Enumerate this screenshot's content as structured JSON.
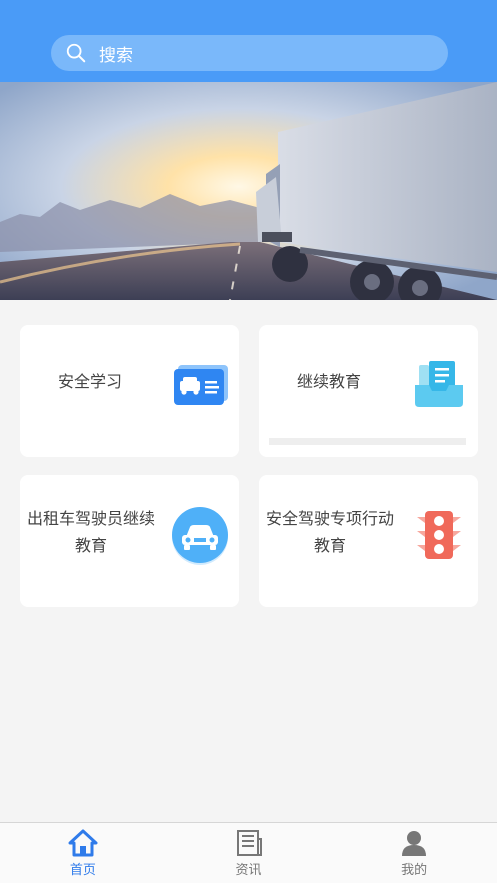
{
  "search": {
    "placeholder": "搜索"
  },
  "cards": [
    {
      "label": "安全学习"
    },
    {
      "label": "继续教育"
    },
    {
      "label_line1": "出租车驾驶员继续",
      "label_line2": "教育"
    },
    {
      "label_line1": "安全驾驶专项行动",
      "label_line2": "教育"
    }
  ],
  "tabs": [
    {
      "label": "首页",
      "active": true
    },
    {
      "label": "资讯",
      "active": false
    },
    {
      "label": "我的",
      "active": false
    }
  ],
  "colors": {
    "primary": "#4a9bf7",
    "tab_active": "#2f7bea"
  }
}
